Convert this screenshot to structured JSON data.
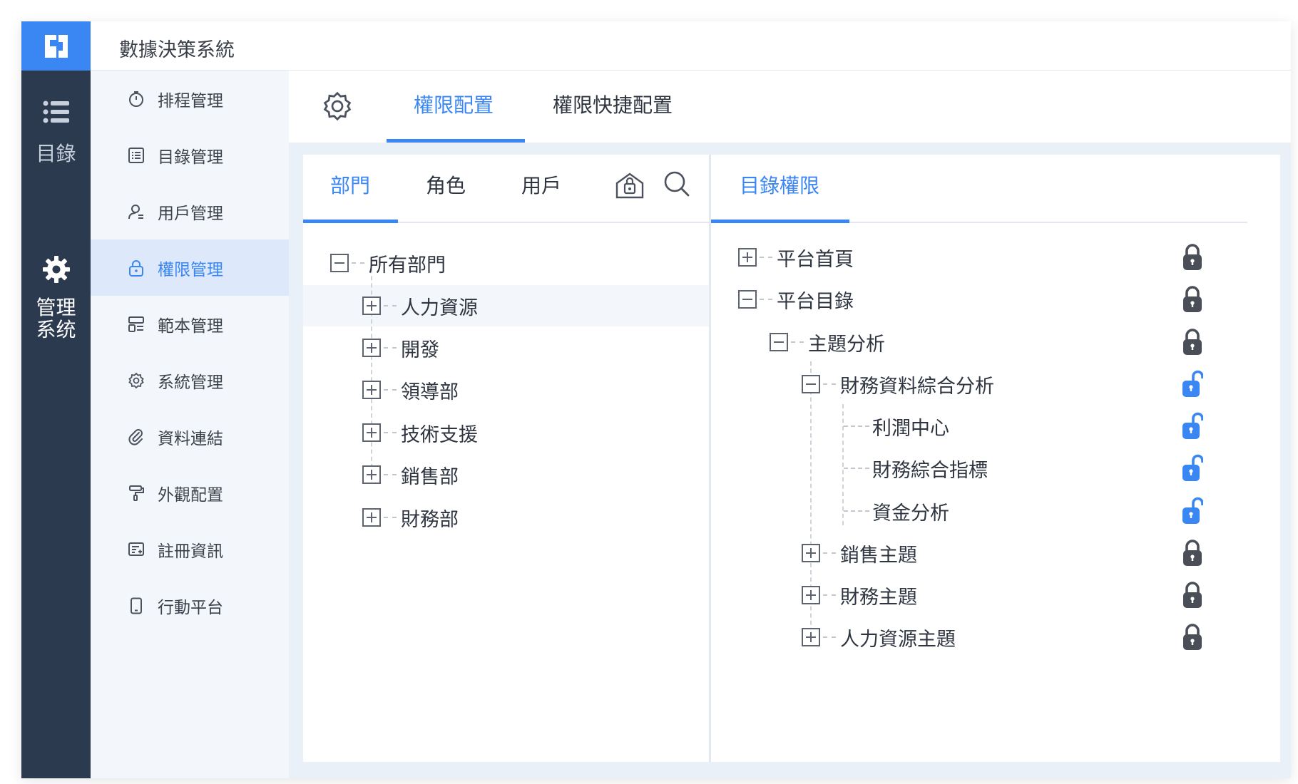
{
  "app": {
    "title": "數據決策系統"
  },
  "rail": [
    {
      "label": "目錄",
      "icon": "list-icon"
    },
    {
      "label": "管理\n系统",
      "label_lines": [
        "管理",
        "系统"
      ],
      "icon": "gear-icon"
    }
  ],
  "menu": [
    {
      "label": "排程管理",
      "icon": "timer-icon"
    },
    {
      "label": "目錄管理",
      "icon": "list-doc-icon"
    },
    {
      "label": "用戶管理",
      "icon": "user-icon"
    },
    {
      "label": "權限管理",
      "icon": "lock-icon"
    },
    {
      "label": "範本管理",
      "icon": "template-icon"
    },
    {
      "label": "系統管理",
      "icon": "gear-icon"
    },
    {
      "label": "資料連結",
      "icon": "paperclip-icon"
    },
    {
      "label": "外觀配置",
      "icon": "paint-roller-icon"
    },
    {
      "label": "註冊資訊",
      "icon": "register-icon"
    },
    {
      "label": "行動平台",
      "icon": "mobile-icon"
    }
  ],
  "top_tabs": {
    "first": "權限配置",
    "second": "權限快捷配置"
  },
  "left_panel": {
    "tabs": [
      "部門",
      "角色",
      "用戶"
    ],
    "root": "所有部門",
    "departments": [
      "人力資源",
      "開發",
      "領導部",
      "技術支援",
      "銷售部",
      "財務部"
    ]
  },
  "right_panel": {
    "tab": "目錄權限",
    "tree": [
      {
        "label": "平台首頁",
        "locked": true
      },
      {
        "label": "平台目錄",
        "locked": true
      },
      {
        "label": "主題分析",
        "locked": true
      },
      {
        "label": "財務資料綜合分析",
        "locked": false
      },
      {
        "label": "利潤中心",
        "locked": false
      },
      {
        "label": "財務綜合指標",
        "locked": false
      },
      {
        "label": "資金分析",
        "locked": false
      },
      {
        "label": "銷售主題",
        "locked": true
      },
      {
        "label": "財務主題",
        "locked": true
      },
      {
        "label": "人力資源主題",
        "locked": true
      }
    ]
  },
  "colors": {
    "accent": "#3a86f3",
    "rail": "#2c3a50",
    "lock_dark": "#4a4f57"
  }
}
